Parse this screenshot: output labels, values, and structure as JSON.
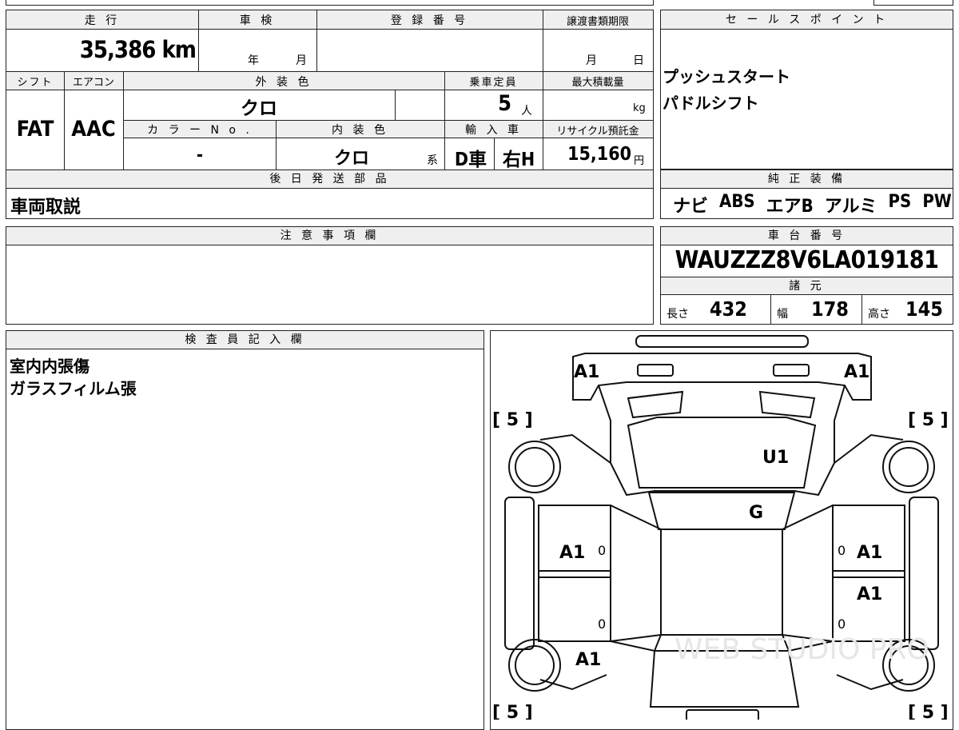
{
  "summary": {
    "mileage_label": "走 行",
    "mileage": "35,386 km",
    "inspection_label": "車 検",
    "inspection_year_unit": "年",
    "inspection_month_unit": "月",
    "registration_label": "登 録 番 号",
    "transfer_deadline_label": "譲渡書類期限",
    "transfer_month_unit": "月",
    "transfer_day_unit": "日",
    "shift_label": "シフト",
    "shift": "FAT",
    "aircon_label": "エアコン",
    "aircon": "AAC",
    "exterior_color_label": "外 装 色",
    "exterior_color": "クロ",
    "capacity_label": "乗車定員",
    "capacity": "5",
    "capacity_unit": "人",
    "max_load_label": "最大積載量",
    "max_load_unit": "kg",
    "color_no_label": "カ ラ ー N o .",
    "color_no": "-",
    "interior_color_label": "内 装 色",
    "interior_color": "クロ",
    "interior_color_suffix": "系",
    "import_label": "輸 入 車",
    "import_type": "D車",
    "steering": "右H",
    "recycle_label": "リサイクル預託金",
    "recycle_fee": "15,160",
    "recycle_unit": "円",
    "later_parts_label": "後 日 発 送 部 品",
    "later_parts": "車両取説"
  },
  "sales_points": {
    "label": "セ ー ル ス ポ イ ン ト",
    "items": [
      "プッシュスタート",
      "パドルシフト"
    ]
  },
  "equipment": {
    "label": "純 正 装 備",
    "items": [
      "ナビ",
      "ABS",
      "エアB",
      "アルミ",
      "PS",
      "PW"
    ]
  },
  "notes": {
    "label": "注 意 事 項 欄",
    "text": ""
  },
  "chassis": {
    "label": "車 台 番 号",
    "number": "WAUZZZ8V6LA019181"
  },
  "specs": {
    "label": "諸 元",
    "length_label": "長さ",
    "length": "432",
    "width_label": "幅",
    "width": "178",
    "height_label": "高さ",
    "height": "145"
  },
  "inspector": {
    "label": "検 査 員 記 入 欄",
    "lines": [
      "室内内張傷",
      "ガラスフィルム張"
    ]
  },
  "diagram": {
    "front_left": "A1",
    "front_right": "A1",
    "tire_fl": "[ 5 ]",
    "tire_fr": "[ 5 ]",
    "tire_rl": "[ 5 ]",
    "tire_rr": "[ 5 ]",
    "windshield": "U1",
    "roof": "G",
    "left_front_door": "A1",
    "right_front_door": "A1",
    "right_rear_door": "A1",
    "left_rear": "A1",
    "zero_mark": "0",
    "watermark": "WEB STUDIO PRO"
  }
}
